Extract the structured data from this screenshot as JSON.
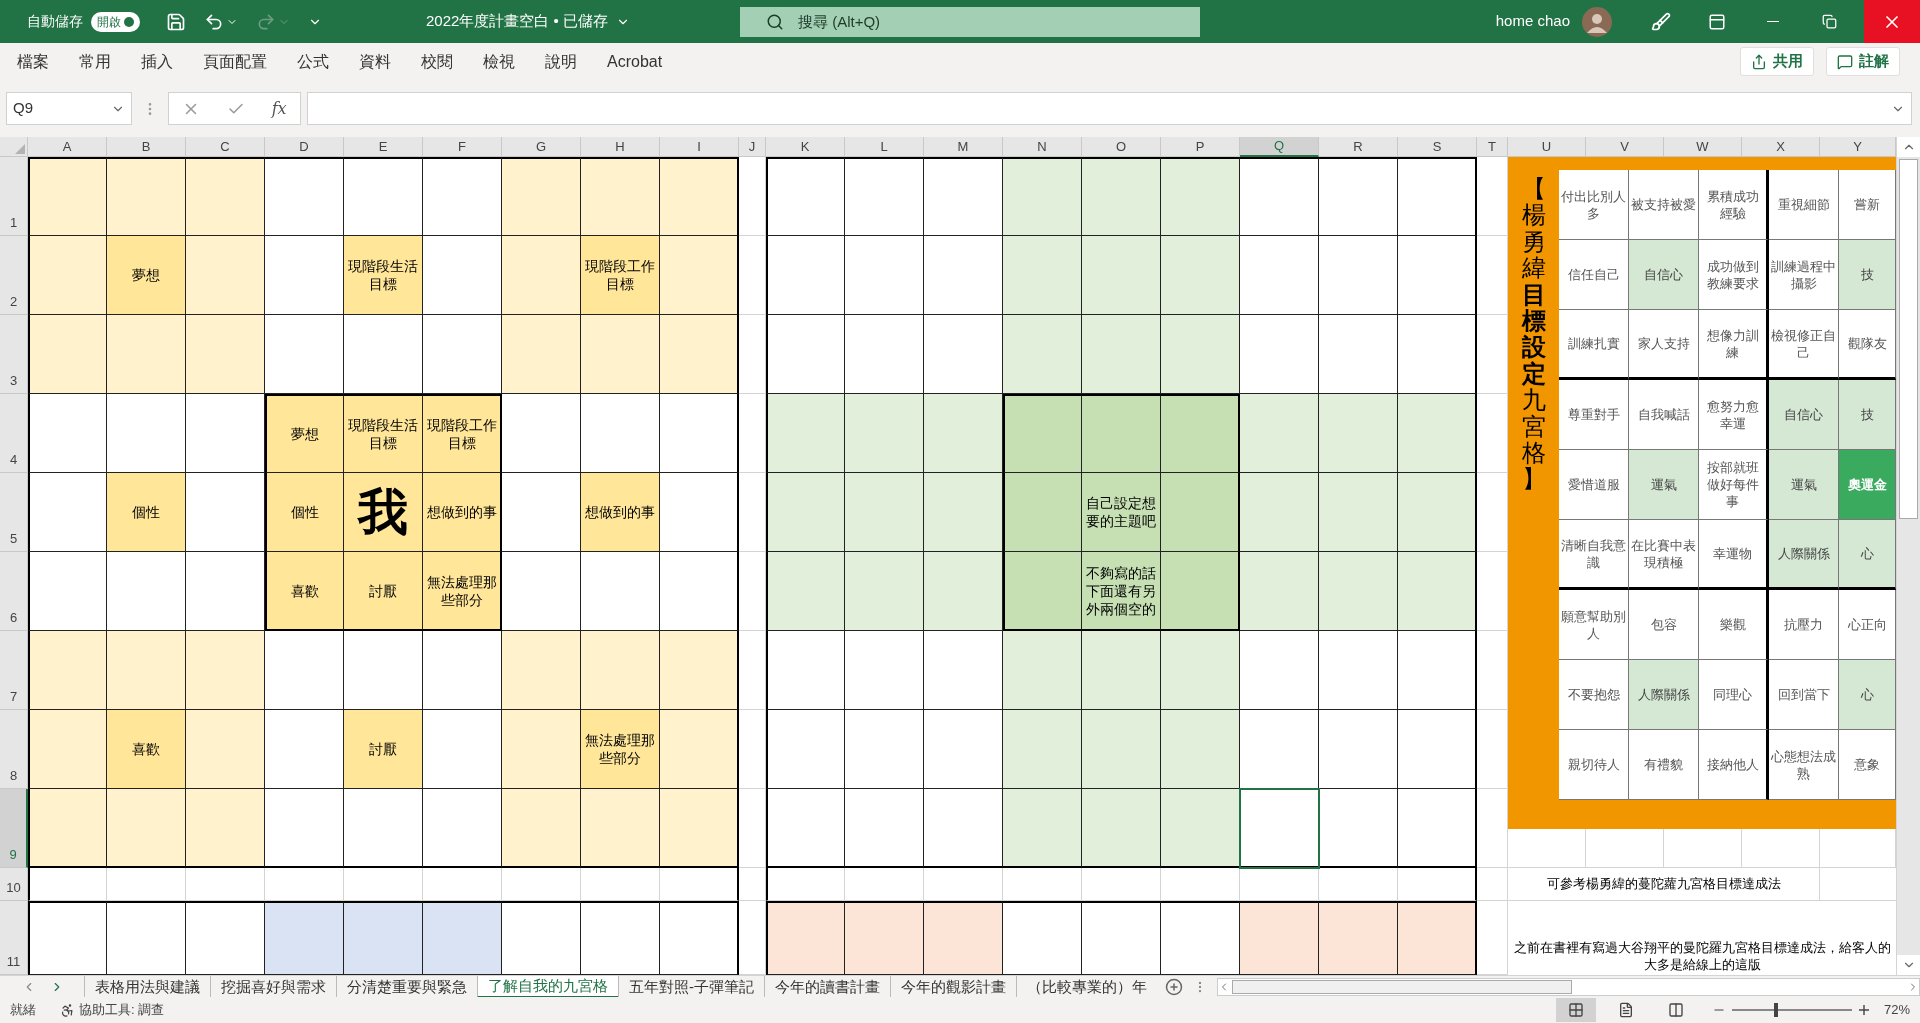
{
  "title_bar": {
    "autosave_label": "自動儲存",
    "autosave_toggle": {
      "label": "開啟",
      "on": true
    },
    "quick_access": [
      {
        "kind": "save",
        "disabled": false
      },
      {
        "kind": "undo",
        "disabled": false
      },
      {
        "kind": "redo",
        "disabled": true
      },
      {
        "kind": "customize",
        "disabled": false
      }
    ],
    "document_title": "2022年度計畫空白 • 已儲存",
    "search": {
      "placeholder": "搜尋 (Alt+Q)"
    },
    "user": "home chao"
  },
  "menu": {
    "tabs": [
      "檔案",
      "常用",
      "插入",
      "頁面配置",
      "公式",
      "資料",
      "校閱",
      "檢視",
      "說明",
      "Acrobat"
    ],
    "share": "共用",
    "comments": "註解"
  },
  "formula_bar": {
    "name_box": "Q9",
    "function_label": "fx"
  },
  "sheet": {
    "columns": [
      {
        "label": "A",
        "selected": false
      },
      {
        "label": "B",
        "selected": false
      },
      {
        "label": "C",
        "selected": false
      },
      {
        "label": "D",
        "selected": false
      },
      {
        "label": "E",
        "selected": false
      },
      {
        "label": "F",
        "selected": false
      },
      {
        "label": "G",
        "selected": false
      },
      {
        "label": "H",
        "selected": false
      },
      {
        "label": "I",
        "selected": false
      },
      {
        "label": "J",
        "selected": false
      },
      {
        "label": "K",
        "selected": false
      },
      {
        "label": "L",
        "selected": false
      },
      {
        "label": "M",
        "selected": false
      },
      {
        "label": "N",
        "selected": false
      },
      {
        "label": "O",
        "selected": false
      },
      {
        "label": "P",
        "selected": false
      },
      {
        "label": "Q",
        "selected": true
      },
      {
        "label": "R",
        "selected": false
      },
      {
        "label": "S",
        "selected": false
      },
      {
        "label": "T",
        "selected": false
      },
      {
        "label": "U",
        "selected": false
      },
      {
        "label": "V",
        "selected": false
      },
      {
        "label": "W",
        "selected": false
      },
      {
        "label": "X",
        "selected": false
      },
      {
        "label": "Y",
        "selected": false
      }
    ],
    "rows": [
      {
        "label": "1",
        "selected": false,
        "cells": [
          {
            "color": "#fff2cc"
          },
          {
            "color": "#fff2cc"
          },
          {
            "color": "#fff2cc"
          },
          {},
          {},
          {},
          {
            "color": "#fff2cc"
          },
          {
            "color": "#fff2cc"
          },
          {
            "color": "#fff2cc"
          },
          {},
          {},
          {},
          {},
          {
            "color": "#e2efda"
          },
          {
            "color": "#e2efda"
          },
          {
            "color": "#e2efda"
          },
          {},
          {},
          {},
          {}
        ]
      },
      {
        "label": "2",
        "selected": false,
        "cells": [
          {
            "color": "#fff2cc"
          },
          {
            "color": "#ffe699",
            "text": "夢想"
          },
          {
            "color": "#fff2cc"
          },
          {},
          {
            "color": "#ffe699",
            "text": "現階段生活目標"
          },
          {},
          {
            "color": "#fff2cc"
          },
          {
            "color": "#ffe699",
            "text": "現階段工作目標"
          },
          {
            "color": "#fff2cc"
          },
          {},
          {},
          {},
          {},
          {
            "color": "#e2efda"
          },
          {
            "color": "#e2efda"
          },
          {
            "color": "#e2efda"
          },
          {},
          {},
          {},
          {}
        ]
      },
      {
        "label": "3",
        "selected": false,
        "cells": [
          {
            "color": "#fff2cc"
          },
          {
            "color": "#fff2cc"
          },
          {
            "color": "#fff2cc"
          },
          {},
          {},
          {},
          {
            "color": "#fff2cc"
          },
          {
            "color": "#fff2cc"
          },
          {
            "color": "#fff2cc"
          },
          {},
          {},
          {},
          {},
          {
            "color": "#e2efda"
          },
          {
            "color": "#e2efda"
          },
          {
            "color": "#e2efda"
          },
          {},
          {},
          {},
          {}
        ]
      },
      {
        "label": "4",
        "selected": false,
        "cells": [
          {},
          {},
          {},
          {
            "color": "#ffe699",
            "text": "夢想"
          },
          {
            "color": "#ffe699",
            "text": "現階段生活目標"
          },
          {
            "color": "#ffe699",
            "text": "現階段工作目標"
          },
          {},
          {},
          {},
          {},
          {
            "color": "#e2efda"
          },
          {
            "color": "#e2efda"
          },
          {
            "color": "#e2efda"
          },
          {
            "color": "#c6e0b4"
          },
          {
            "color": "#c6e0b4"
          },
          {
            "color": "#c6e0b4"
          },
          {
            "color": "#e2efda"
          },
          {
            "color": "#e2efda"
          },
          {
            "color": "#e2efda"
          },
          {}
        ]
      },
      {
        "label": "5",
        "selected": false,
        "cells": [
          {},
          {
            "color": "#ffe699",
            "text": "個性"
          },
          {},
          {
            "color": "#ffe699",
            "text": "個性"
          },
          {
            "color": "#ffe699",
            "heading": "我"
          },
          {
            "color": "#ffe699",
            "text": "想做到的事"
          },
          {},
          {
            "color": "#ffe699",
            "text": "想做到的事"
          },
          {},
          {},
          {
            "color": "#e2efda"
          },
          {
            "color": "#e2efda"
          },
          {
            "color": "#e2efda"
          },
          {
            "color": "#c6e0b4"
          },
          {
            "color": "#c6e0b4",
            "text": "自己設定想要的主題吧"
          },
          {
            "color": "#c6e0b4"
          },
          {
            "color": "#e2efda"
          },
          {
            "color": "#e2efda"
          },
          {
            "color": "#e2efda"
          },
          {}
        ]
      },
      {
        "label": "6",
        "selected": false,
        "cells": [
          {},
          {},
          {},
          {
            "color": "#ffe699",
            "text": "喜歡"
          },
          {
            "color": "#ffe699",
            "text": "討厭"
          },
          {
            "color": "#ffe699",
            "text": "無法處理那些部分"
          },
          {},
          {},
          {},
          {},
          {
            "color": "#e2efda"
          },
          {
            "color": "#e2efda"
          },
          {
            "color": "#e2efda"
          },
          {
            "color": "#c6e0b4"
          },
          {
            "color": "#c6e0b4",
            "text": "不夠寫的話下面還有另外兩個空的"
          },
          {
            "color": "#c6e0b4"
          },
          {
            "color": "#e2efda"
          },
          {
            "color": "#e2efda"
          },
          {
            "color": "#e2efda"
          },
          {}
        ]
      },
      {
        "label": "7",
        "selected": false,
        "cells": [
          {
            "color": "#fff2cc"
          },
          {
            "color": "#fff2cc"
          },
          {
            "color": "#fff2cc"
          },
          {},
          {},
          {},
          {
            "color": "#fff2cc"
          },
          {
            "color": "#fff2cc"
          },
          {
            "color": "#fff2cc"
          },
          {},
          {},
          {},
          {},
          {
            "color": "#e2efda"
          },
          {
            "color": "#e2efda"
          },
          {
            "color": "#e2efda"
          },
          {},
          {},
          {},
          {}
        ]
      },
      {
        "label": "8",
        "selected": false,
        "cells": [
          {
            "color": "#fff2cc"
          },
          {
            "color": "#ffe699",
            "text": "喜歡"
          },
          {
            "color": "#fff2cc"
          },
          {},
          {
            "color": "#ffe699",
            "text": "討厭"
          },
          {},
          {
            "color": "#fff2cc"
          },
          {
            "color": "#ffe699",
            "text": "無法處理那些部分"
          },
          {
            "color": "#fff2cc"
          },
          {},
          {},
          {},
          {},
          {
            "color": "#e2efda"
          },
          {
            "color": "#e2efda"
          },
          {
            "color": "#e2efda"
          },
          {},
          {},
          {},
          {}
        ]
      },
      {
        "label": "9",
        "selected": true,
        "cells": [
          {
            "color": "#fff2cc"
          },
          {
            "color": "#fff2cc"
          },
          {
            "color": "#fff2cc"
          },
          {},
          {},
          {},
          {
            "color": "#fff2cc"
          },
          {
            "color": "#fff2cc"
          },
          {
            "color": "#fff2cc"
          },
          {},
          {},
          {},
          {},
          {
            "color": "#e2efda"
          },
          {
            "color": "#e2efda"
          },
          {
            "color": "#e2efda"
          },
          {},
          {},
          {},
          {}
        ]
      },
      {
        "label": "10",
        "selected": false,
        "cells": [
          {},
          {},
          {},
          {},
          {},
          {},
          {},
          {},
          {},
          {},
          {},
          {},
          {},
          {},
          {},
          {},
          {},
          {},
          {},
          {}
        ]
      },
      {
        "label": "11",
        "selected": false,
        "cells": [
          {},
          {},
          {},
          {
            "color": "#dae3f3"
          },
          {
            "color": "#dae3f3"
          },
          {
            "color": "#dae3f3"
          },
          {},
          {},
          {},
          {},
          {
            "color": "#fce4d6"
          },
          {
            "color": "#fce4d6"
          },
          {
            "color": "#fce4d6"
          },
          {},
          {},
          {},
          {
            "color": "#fce4d6"
          },
          {
            "color": "#fce4d6"
          },
          {
            "color": "#fce4d6"
          },
          {}
        ]
      }
    ],
    "notes": {
      "reference": "可參考楊勇緯的蔓陀蘿九宮格目標達成法",
      "remark": "之前在書裡有寫過大谷翔平的曼陀羅九宮格目標達成法，給客人的大多是給線上的這版"
    }
  },
  "goal_chart": {
    "title": "【楊勇緯**目標設定**九宮格】",
    "rows": [
      [
        {
          "text": "付出比別人多",
          "kind": "plain"
        },
        {
          "text": "被支持被愛",
          "kind": "plain"
        },
        {
          "text": "累積成功經驗",
          "kind": "plain"
        },
        {
          "text": "重視細節",
          "kind": "plain"
        },
        {
          "text": "嘗新",
          "kind": "plain"
        }
      ],
      [
        {
          "text": "信任自己",
          "kind": "plain"
        },
        {
          "text": "自信心",
          "kind": "highlight"
        },
        {
          "text": "成功做到教練要求",
          "kind": "plain"
        },
        {
          "text": "訓練過程中攝影",
          "kind": "plain"
        },
        {
          "text": "技",
          "kind": "highlight"
        }
      ],
      [
        {
          "text": "訓練扎實",
          "kind": "plain"
        },
        {
          "text": "家人支持",
          "kind": "plain"
        },
        {
          "text": "想像力訓練",
          "kind": "plain"
        },
        {
          "text": "檢視修正自己",
          "kind": "plain"
        },
        {
          "text": "觀隊友",
          "kind": "plain"
        }
      ],
      [
        {
          "text": "尊重對手",
          "kind": "plain"
        },
        {
          "text": "自我喊話",
          "kind": "plain"
        },
        {
          "text": "愈努力愈幸運",
          "kind": "plain"
        },
        {
          "text": "自信心",
          "kind": "highlight"
        },
        {
          "text": "技",
          "kind": "highlight"
        }
      ],
      [
        {
          "text": "愛惜道服",
          "kind": "plain"
        },
        {
          "text": "運氣",
          "kind": "highlight"
        },
        {
          "text": "按部就班做好每件事",
          "kind": "plain"
        },
        {
          "text": "運氣",
          "kind": "highlight"
        },
        {
          "text": "奧運金",
          "kind": "key"
        }
      ],
      [
        {
          "text": "清晰自我意識",
          "kind": "plain"
        },
        {
          "text": "在比賽中表現積極",
          "kind": "plain"
        },
        {
          "text": "幸運物",
          "kind": "plain"
        },
        {
          "text": "人際關係",
          "kind": "highlight"
        },
        {
          "text": "心",
          "kind": "highlight"
        }
      ],
      [
        {
          "text": "願意幫助別人",
          "kind": "plain"
        },
        {
          "text": "包容",
          "kind": "plain"
        },
        {
          "text": "樂觀",
          "kind": "plain"
        },
        {
          "text": "抗壓力",
          "kind": "plain"
        },
        {
          "text": "心正向",
          "kind": "plain"
        }
      ],
      [
        {
          "text": "不要抱怨",
          "kind": "plain"
        },
        {
          "text": "人際關係",
          "kind": "highlight"
        },
        {
          "text": "同理心",
          "kind": "plain"
        },
        {
          "text": "回到當下",
          "kind": "plain"
        },
        {
          "text": "心",
          "kind": "highlight"
        }
      ],
      [
        {
          "text": "親切待人",
          "kind": "plain"
        },
        {
          "text": "有禮貌",
          "kind": "plain"
        },
        {
          "text": "接納他人",
          "kind": "plain"
        },
        {
          "text": "心態想法成熟",
          "kind": "plain"
        },
        {
          "text": "意象",
          "kind": "plain"
        }
      ]
    ]
  },
  "sheet_tabs": [
    {
      "label": "表格用法與建議",
      "selected": false
    },
    {
      "label": "挖掘喜好與需求",
      "selected": false
    },
    {
      "label": "分清楚重要與緊急",
      "selected": false
    },
    {
      "label": "了解自我的九宮格",
      "selected": true
    },
    {
      "label": "五年對照-子彈筆記",
      "selected": false
    },
    {
      "label": "今年的讀書計畫",
      "selected": false
    },
    {
      "label": "今年的觀影計畫",
      "selected": false
    },
    {
      "label": "（比較專業的）年",
      "selected": false
    }
  ],
  "status_bar": {
    "ready": "就緒",
    "accessibility": "協助工具: 調查",
    "views": [
      {
        "kind": "normal",
        "selected": true
      },
      {
        "kind": "page_layout",
        "selected": false
      },
      {
        "kind": "page_break",
        "selected": false
      }
    ],
    "zoom": {
      "level": 0.35,
      "reading": "72%"
    }
  }
}
